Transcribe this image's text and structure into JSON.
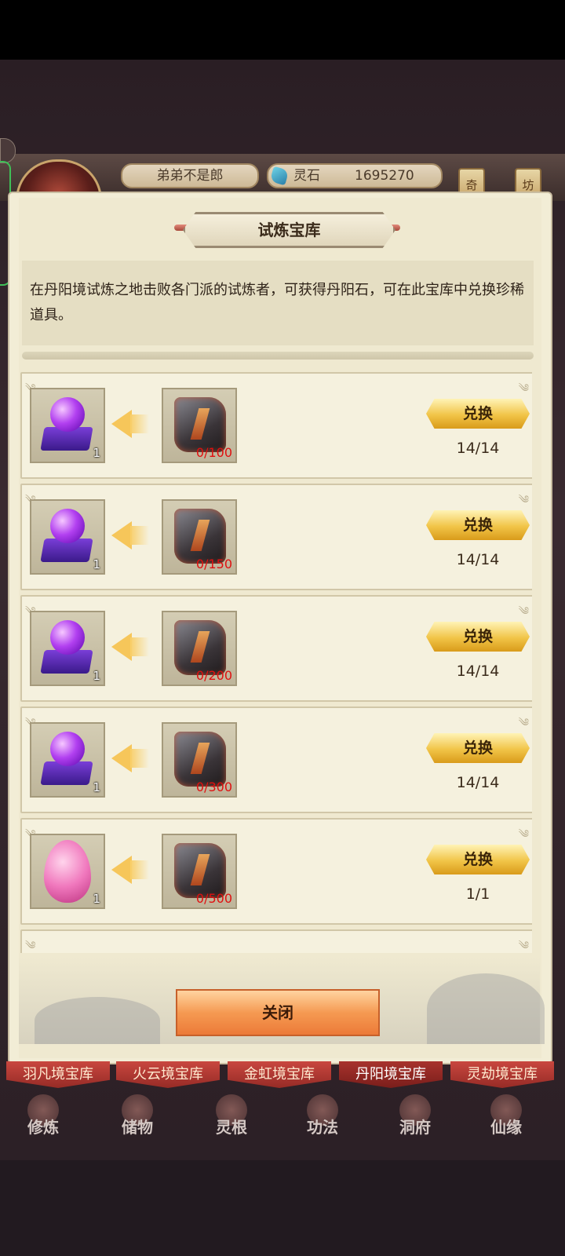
{
  "player": {
    "name": "弟弟不是郎"
  },
  "resource": {
    "label": "灵石",
    "value": "1695270",
    "icon": "spirit-stone-gem-icon"
  },
  "side_tags": [
    "奇",
    "坊"
  ],
  "modal": {
    "title": "试炼宝库",
    "description": "在丹阳境试炼之地击败各门派的试炼者，可获得丹阳石，可在此宝库中兑换珍稀道具。",
    "close_label": "关闭"
  },
  "exchange_rows": [
    {
      "reward_icon": "purple-orb-on-stand-icon",
      "reward_count": "1",
      "cost_icon": "danyang-stone-icon",
      "cost": "0/100",
      "button": "兑换",
      "limit": "14/14"
    },
    {
      "reward_icon": "purple-orb-on-stand-icon",
      "reward_count": "1",
      "cost_icon": "danyang-stone-icon",
      "cost": "0/150",
      "button": "兑换",
      "limit": "14/14"
    },
    {
      "reward_icon": "purple-orb-on-stand-icon",
      "reward_count": "1",
      "cost_icon": "danyang-stone-icon",
      "cost": "0/200",
      "button": "兑换",
      "limit": "14/14"
    },
    {
      "reward_icon": "purple-orb-on-stand-icon",
      "reward_count": "1",
      "cost_icon": "danyang-stone-icon",
      "cost": "0/300",
      "button": "兑换",
      "limit": "14/14"
    },
    {
      "reward_icon": "pink-egg-icon",
      "reward_count": "1",
      "cost_icon": "danyang-stone-icon",
      "cost": "0/500",
      "button": "兑换",
      "limit": "1/1"
    }
  ],
  "tabs": [
    {
      "label": "羽凡境宝库",
      "active": false
    },
    {
      "label": "火云境宝库",
      "active": false
    },
    {
      "label": "金虹境宝库",
      "active": false
    },
    {
      "label": "丹阳境宝库",
      "active": true
    },
    {
      "label": "灵劫境宝库",
      "active": false
    }
  ],
  "bottom_nav": [
    "修炼",
    "储物",
    "灵根",
    "功法",
    "洞府",
    "仙缘"
  ]
}
